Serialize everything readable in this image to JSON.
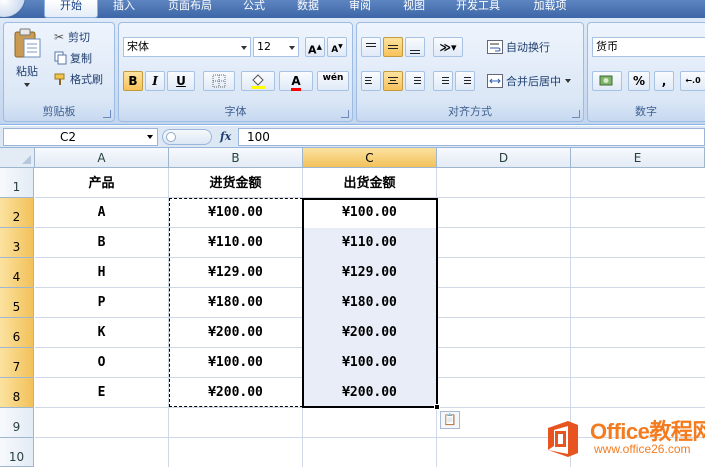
{
  "ribbon": {
    "tabs": [
      "开始",
      "插入",
      "页面布局",
      "公式",
      "数据",
      "审阅",
      "视图",
      "开发工具",
      "加载项"
    ],
    "active_tab": "开始",
    "clipboard": {
      "paste_label": "粘贴",
      "cut_label": "剪切",
      "copy_label": "复制",
      "format_painter_label": "格式刷",
      "group_label": "剪贴板"
    },
    "font": {
      "font_name": "宋体",
      "font_size": "12",
      "bold": "B",
      "italic": "I",
      "underline": "U",
      "phonetic": "wén",
      "group_label": "字体",
      "fill_color": "#ffff00",
      "font_color": "#ff0000"
    },
    "alignment": {
      "wrap_text_label": "自动换行",
      "merge_center_label": "合并后居中",
      "group_label": "对齐方式"
    },
    "number": {
      "format": "货币",
      "percent": "%",
      "comma": ",",
      "group_label": "数字"
    }
  },
  "formula_bar": {
    "name_box": "C2",
    "fx": "fx",
    "formula": "100"
  },
  "sheet": {
    "columns": [
      "A",
      "B",
      "C",
      "D",
      "E"
    ],
    "rows": [
      "1",
      "2",
      "3",
      "4",
      "5",
      "6",
      "7",
      "8",
      "9",
      "10"
    ],
    "selected_column": "C",
    "header": [
      "产品",
      "进货金额",
      "出货金额"
    ],
    "data": [
      [
        "A",
        "¥100.00",
        "¥100.00"
      ],
      [
        "B",
        "¥110.00",
        "¥110.00"
      ],
      [
        "H",
        "¥129.00",
        "¥129.00"
      ],
      [
        "P",
        "¥180.00",
        "¥180.00"
      ],
      [
        "K",
        "¥200.00",
        "¥200.00"
      ],
      [
        "O",
        "¥100.00",
        "¥100.00"
      ],
      [
        "E",
        "¥200.00",
        "¥200.00"
      ]
    ]
  },
  "watermark": {
    "brand": "Office教程网",
    "url": "www.office26.com"
  }
}
